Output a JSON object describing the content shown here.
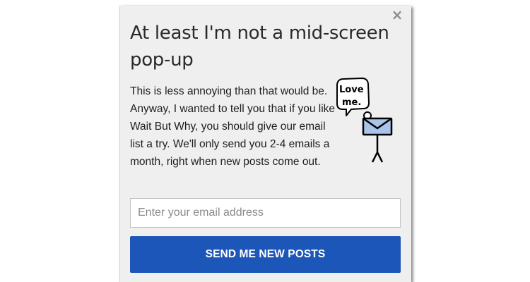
{
  "popup": {
    "close_label": "×",
    "title": "At least I'm not a mid-screen pop-up",
    "body": "This is less annoying than that would be. Anyway, I wanted to tell you that if you like Wait But Why, you should give our email list a try. We'll only send you 2-4 emails a month, right when new posts come out.",
    "illustration": {
      "speech_bubble_line1": "Love",
      "speech_bubble_line2": "me."
    },
    "email_input": {
      "value": "",
      "placeholder": "Enter your email address"
    },
    "submit_label": "SEND ME NEW POSTS"
  },
  "colors": {
    "popup_background": "#efefef",
    "button_background": "#1c56b8",
    "button_text": "#ffffff",
    "envelope_fill": "#a9c3ea",
    "close_icon": "#8c8c8c"
  }
}
